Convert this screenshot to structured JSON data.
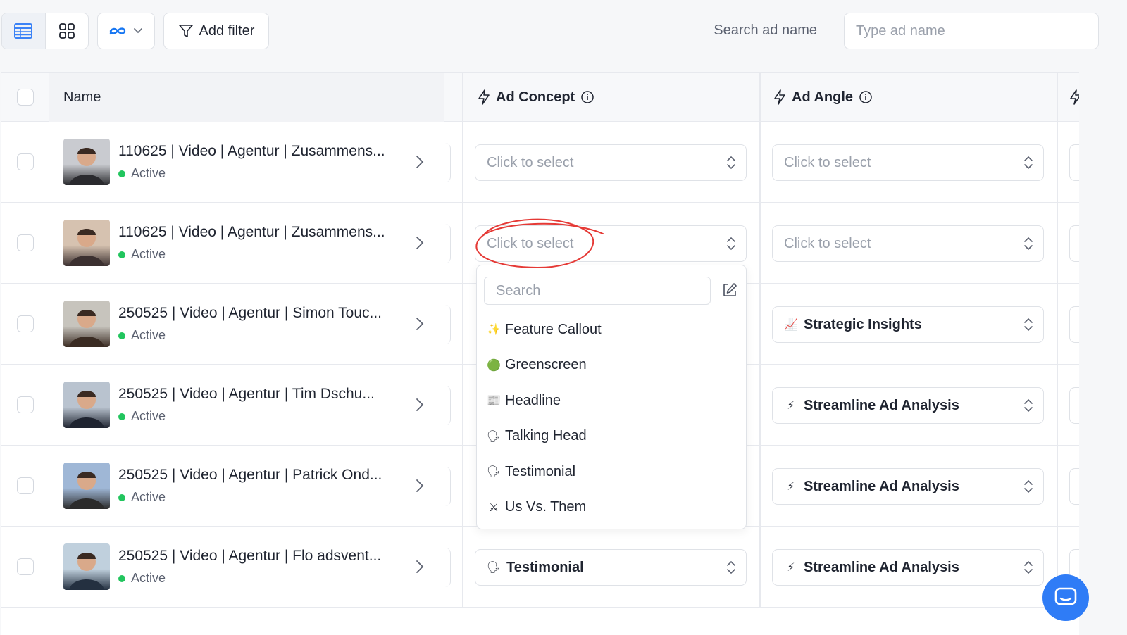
{
  "toolbar": {
    "add_filter_label": "Add filter",
    "search_label": "Search ad name",
    "search_placeholder": "Type ad name"
  },
  "table": {
    "columns": {
      "name": "Name",
      "ad_concept": "Ad Concept",
      "ad_angle": "Ad Angle"
    },
    "rows": [
      {
        "title": "110625 | Video | Agentur | Zusammens...",
        "status": "Active",
        "concept": "Click to select",
        "concept_set": false,
        "angle": "Click to select",
        "angle_set": false
      },
      {
        "title": "110625 | Video | Agentur | Zusammens...",
        "status": "Active",
        "concept": "Click to select",
        "concept_set": false,
        "angle": "Click to select",
        "angle_set": false
      },
      {
        "title": "250525 | Video | Agentur | Simon Touc...",
        "status": "Active",
        "concept": "",
        "concept_set": false,
        "angle": "Strategic Insights",
        "angle_icon": "📈",
        "angle_set": true
      },
      {
        "title": "250525 | Video | Agentur | Tim Dschu...",
        "status": "Active",
        "concept": "",
        "concept_set": false,
        "angle": "Streamline Ad Analysis",
        "angle_icon": "⚡",
        "angle_set": true
      },
      {
        "title": "250525 | Video | Agentur | Patrick Ond...",
        "status": "Active",
        "concept": "",
        "concept_set": false,
        "angle": "Streamline Ad Analysis",
        "angle_icon": "⚡",
        "angle_set": true
      },
      {
        "title": "250525 | Video | Agentur | Flo adsvent...",
        "status": "Active",
        "concept": "Testimonial",
        "concept_icon": "🗣",
        "concept_set": true,
        "angle": "Streamline Ad Analysis",
        "angle_icon": "⚡",
        "angle_set": true
      }
    ]
  },
  "dropdown": {
    "search_placeholder": "Search",
    "options": [
      {
        "icon": "✨",
        "label": "Feature Callout"
      },
      {
        "icon": "🟢",
        "label": "Greenscreen"
      },
      {
        "icon": "📰",
        "label": "Headline"
      },
      {
        "icon": "🗣",
        "label": "Talking Head"
      },
      {
        "icon": "🗣",
        "label": "Testimonial"
      },
      {
        "icon": "⚔",
        "label": "Us Vs. Them"
      }
    ]
  },
  "colors": {
    "accent": "#2f7cf6",
    "status_active": "#22c55e",
    "annotation": "#e53935"
  }
}
